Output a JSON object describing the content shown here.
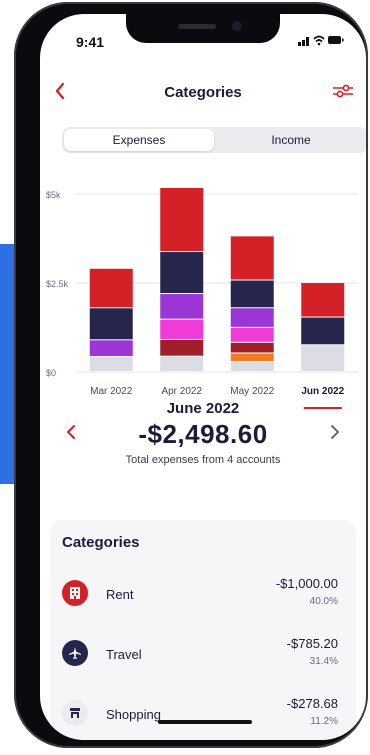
{
  "status": {
    "time": "9:41",
    "icons": "▁▃▅ • ▭"
  },
  "nav": {
    "title": "Categories"
  },
  "segments": {
    "expenses": "Expenses",
    "income": "Income"
  },
  "colors": {
    "accent": "#d42027",
    "navy": "#26264d",
    "purple": "#9b35d6",
    "magenta": "#f03cd6",
    "maroon": "#a01f28",
    "orange": "#f07b22",
    "light": "#dcdce4"
  },
  "chart_data": {
    "type": "bar",
    "stacked": true,
    "y_ticks": [
      "$5k",
      "$2.5k",
      "$0"
    ],
    "ylim": [
      0,
      5000
    ],
    "categories": [
      "Mar 2022",
      "Apr 2022",
      "May 2022",
      "Jun 2022"
    ],
    "selected": "Jun 2022",
    "series_colors": [
      "#dcdce4",
      "#f07b22",
      "#a01f28",
      "#f03cd6",
      "#9b35d6",
      "#26264d",
      "#d42027"
    ],
    "series": [
      {
        "values": [
          420,
          430,
          280,
          750
        ]
      },
      {
        "values": [
          0,
          0,
          240,
          0
        ]
      },
      {
        "values": [
          0,
          470,
          300,
          0
        ]
      },
      {
        "values": [
          0,
          570,
          420,
          0
        ]
      },
      {
        "values": [
          470,
          720,
          550,
          0
        ]
      },
      {
        "values": [
          900,
          1180,
          780,
          780
        ]
      },
      {
        "values": [
          1110,
          1800,
          1240,
          970
        ]
      }
    ]
  },
  "summary": {
    "month": "June 2022",
    "amount": "-$2,498.60",
    "subtitle": "Total expenses from 4 accounts"
  },
  "categories_panel": {
    "heading": "Categories",
    "items": [
      {
        "name": "Rent",
        "amount": "-$1,000.00",
        "percent": "40.0%",
        "icon": "building-icon",
        "bg": "#d42027"
      },
      {
        "name": "Travel",
        "amount": "-$785.20",
        "percent": "31.4%",
        "icon": "airplane-icon",
        "bg": "#26264d"
      },
      {
        "name": "Shopping",
        "amount": "-$278.68",
        "percent": "11.2%",
        "icon": "store-icon",
        "bg": "#ececf0"
      }
    ]
  }
}
